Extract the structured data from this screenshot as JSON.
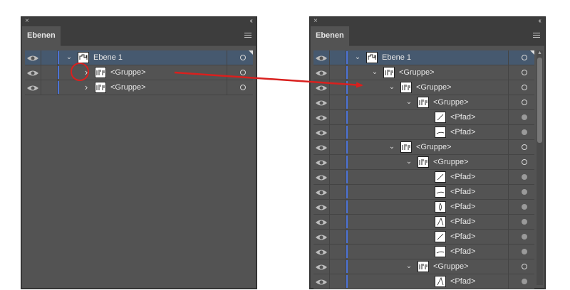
{
  "left_panel": {
    "tab_label": "Ebenen",
    "close_glyph": "×",
    "collapse_glyph": "‹‹",
    "rows": [
      {
        "label": "Ebene 1",
        "indent": 0,
        "chevron": "expanded",
        "selected": true,
        "target": "hollow",
        "corner": true
      },
      {
        "label": "<Gruppe>",
        "indent": 1,
        "chevron": "collapsed",
        "selected": false,
        "target": "hollow",
        "corner": false
      },
      {
        "label": "<Gruppe>",
        "indent": 1,
        "chevron": "collapsed",
        "selected": false,
        "target": "hollow",
        "corner": false
      }
    ]
  },
  "right_panel": {
    "tab_label": "Ebenen",
    "close_glyph": "×",
    "collapse_glyph": "‹‹",
    "rows": [
      {
        "label": "Ebene 1",
        "indent": 0,
        "chevron": "expanded",
        "selected": true,
        "target": "hollow",
        "corner": true
      },
      {
        "label": "<Gruppe>",
        "indent": 1,
        "chevron": "expanded",
        "selected": false,
        "target": "hollow"
      },
      {
        "label": "<Gruppe>",
        "indent": 2,
        "chevron": "expanded",
        "selected": false,
        "target": "hollow"
      },
      {
        "label": "<Gruppe>",
        "indent": 3,
        "chevron": "expanded",
        "selected": false,
        "target": "hollow"
      },
      {
        "label": "<Pfad>",
        "indent": 4,
        "chevron": "none",
        "selected": false,
        "target": "filled"
      },
      {
        "label": "<Pfad>",
        "indent": 4,
        "chevron": "none",
        "selected": false,
        "target": "filled"
      },
      {
        "label": "<Gruppe>",
        "indent": 2,
        "chevron": "expanded",
        "selected": false,
        "target": "hollow"
      },
      {
        "label": "<Gruppe>",
        "indent": 3,
        "chevron": "expanded",
        "selected": false,
        "target": "hollow"
      },
      {
        "label": "<Pfad>",
        "indent": 4,
        "chevron": "none",
        "selected": false,
        "target": "filled"
      },
      {
        "label": "<Pfad>",
        "indent": 4,
        "chevron": "none",
        "selected": false,
        "target": "filled"
      },
      {
        "label": "<Pfad>",
        "indent": 4,
        "chevron": "none",
        "selected": false,
        "target": "filled"
      },
      {
        "label": "<Pfad>",
        "indent": 4,
        "chevron": "none",
        "selected": false,
        "target": "filled"
      },
      {
        "label": "<Pfad>",
        "indent": 4,
        "chevron": "none",
        "selected": false,
        "target": "filled"
      },
      {
        "label": "<Pfad>",
        "indent": 4,
        "chevron": "none",
        "selected": false,
        "target": "filled"
      },
      {
        "label": "<Gruppe>",
        "indent": 3,
        "chevron": "expanded",
        "selected": false,
        "target": "hollow"
      },
      {
        "label": "<Pfad>",
        "indent": 4,
        "chevron": "none",
        "selected": false,
        "target": "filled"
      }
    ]
  },
  "colors": {
    "panel_bg": "#535353",
    "selected_row": "#46596f",
    "layer_color_bar": "#4c73d6",
    "annotation_red": "#d9201e"
  },
  "icons": {
    "visibility": "eye-icon",
    "expand": "chevron-right-icon",
    "collapse": "chevron-down-icon",
    "target": "target-circle-icon",
    "menu": "hamburger-menu-icon"
  }
}
